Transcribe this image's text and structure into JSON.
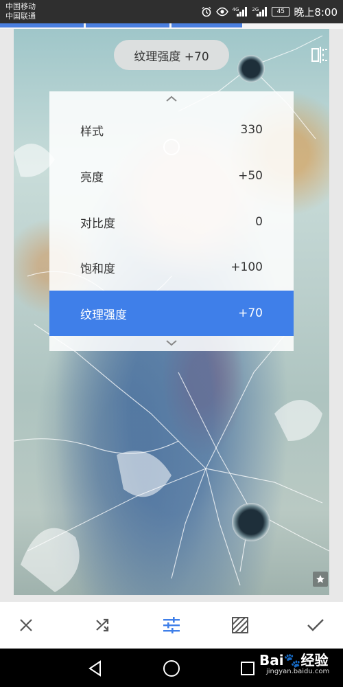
{
  "status_bar": {
    "carrier1": "中国移动",
    "carrier2": "中国联通",
    "net1": "4G",
    "net2": "2G",
    "battery": "45",
    "time": "晚上8:00"
  },
  "editor": {
    "current_label": "纹理强度 +70",
    "params": [
      {
        "name": "样式",
        "value": "330"
      },
      {
        "name": "亮度",
        "value": "+50"
      },
      {
        "name": "对比度",
        "value": "0"
      },
      {
        "name": "饱和度",
        "value": "+100"
      },
      {
        "name": "纹理强度",
        "value": "+70",
        "active": true
      }
    ]
  },
  "toolbar": {
    "icons": [
      "close-icon",
      "shuffle-icon",
      "adjust-sliders-icon",
      "style-icon",
      "check-icon"
    ],
    "active_color": "#3f7fe9"
  },
  "watermark": {
    "brand": "Bai",
    "brand_suffix": "经验",
    "url": "jingyan.baidu.com"
  }
}
